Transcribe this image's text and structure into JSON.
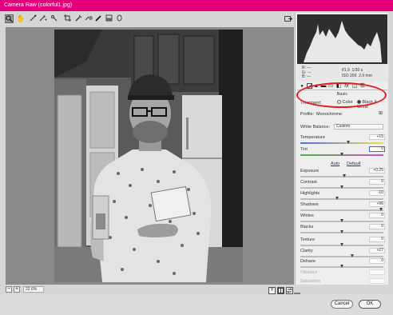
{
  "window": {
    "title": "Camera Raw (colorful1.jpg)"
  },
  "toolbar": {
    "tools": [
      "zoom-tool-icon",
      "hand-tool-icon",
      "white-balance-tool-icon",
      "color-sampler-icon",
      "targeted-adjustment-icon",
      "crop-tool-icon",
      "spot-removal-icon",
      "red-eye-icon",
      "adjustment-brush-icon",
      "graduated-filter-icon",
      "radial-filter-icon"
    ],
    "open_object_icon": "open-object-icon"
  },
  "info": {
    "r_label": "R:",
    "g_label": "G:",
    "b_label": "B:",
    "r_val": "---",
    "g_val": "---",
    "b_val": "---",
    "aperture": "f/1.9",
    "shutter": "1/30 s",
    "iso": "ISO 200",
    "focal": "2.9 mm"
  },
  "panel": {
    "title": "Basic",
    "treatment_label": "Treatment:",
    "color_option": "Color",
    "bw_option": "Black & White",
    "profile_label": "Profile:",
    "profile_value": "Monochrome",
    "wb_label": "White Balance:",
    "wb_value": "Custom",
    "temperature": {
      "label": "Temperature",
      "value": "+15",
      "pos": 0.58
    },
    "tint": {
      "label": "Tint",
      "value": "0",
      "pos": 0.5
    },
    "auto_label": "Auto",
    "default_label": "Default",
    "exposure": {
      "label": "Exposure",
      "value": "+0.25",
      "pos": 0.53
    },
    "contrast": {
      "label": "Contrast",
      "value": "0",
      "pos": 0.5
    },
    "highlights": {
      "label": "Highlights",
      "value": "-10",
      "pos": 0.45
    },
    "shadows": {
      "label": "Shadows",
      "value": "+96",
      "pos": 0.98
    },
    "whites": {
      "label": "Whites",
      "value": "0",
      "pos": 0.5
    },
    "blacks": {
      "label": "Blacks",
      "value": "0",
      "pos": 0.5
    },
    "texture": {
      "label": "Texture",
      "value": "0",
      "pos": 0.5
    },
    "clarity": {
      "label": "Clarity",
      "value": "+27",
      "pos": 0.63
    },
    "dehaze": {
      "label": "Dehaze",
      "value": "0",
      "pos": 0.5
    },
    "vibrance": {
      "label": "Vibrance",
      "value": ""
    },
    "saturation": {
      "label": "Saturation",
      "value": ""
    }
  },
  "zoom": {
    "value": "22.6%",
    "minus": "−",
    "plus": "+"
  },
  "view_buttons": [
    "Y",
    "before-after-icon",
    "swap-icon",
    "settings-menu-icon"
  ],
  "footer": {
    "cancel": "Cancel",
    "ok": "OK"
  },
  "colors": {
    "title_bar": "#e4007c",
    "highlight_circle": "#e31b23"
  }
}
